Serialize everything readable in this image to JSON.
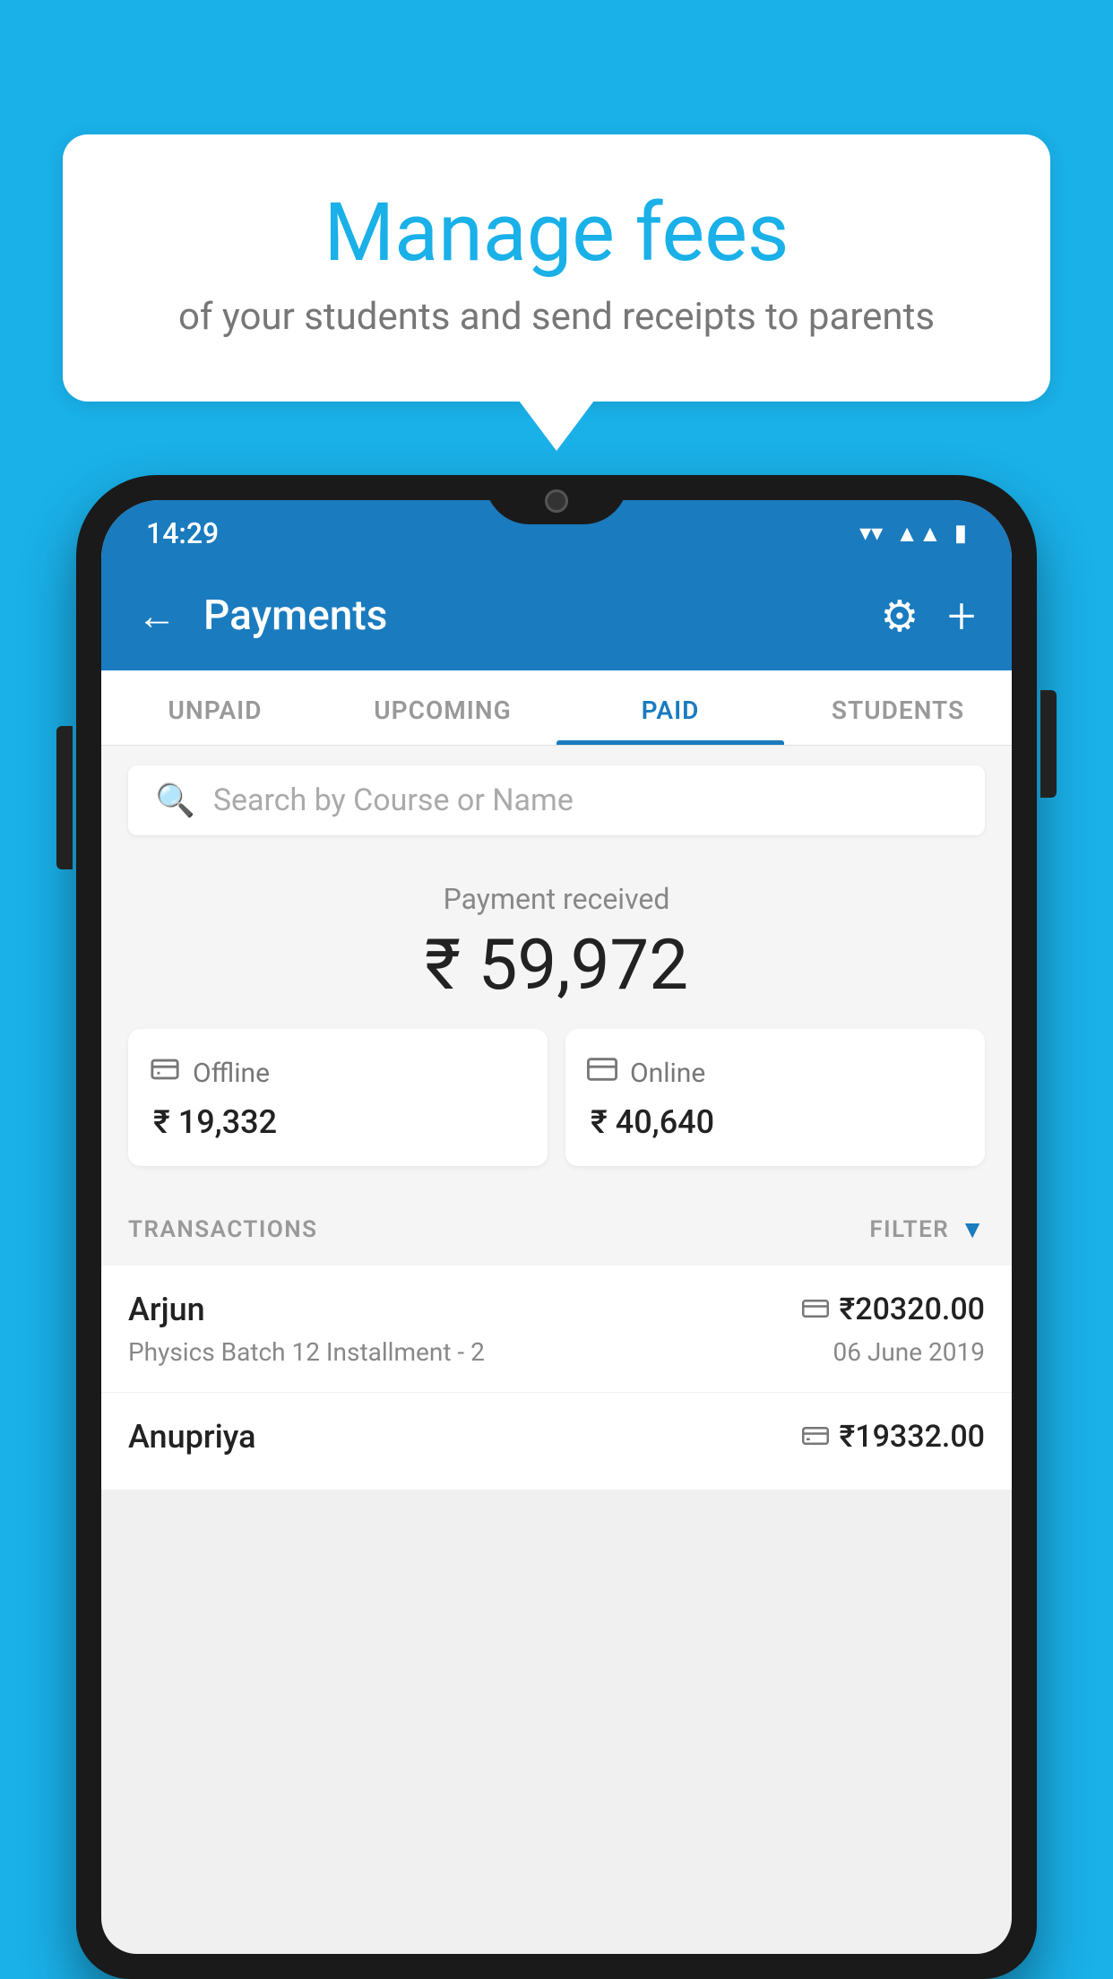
{
  "background_color": "#1ab0e8",
  "speech_bubble": {
    "title": "Manage fees",
    "subtitle": "of your students and send receipts to parents"
  },
  "status_bar": {
    "time": "14:29",
    "wifi": "▼",
    "signal": "▲",
    "battery": "▮"
  },
  "app_bar": {
    "title": "Payments",
    "back_label": "←",
    "gear_label": "⚙",
    "plus_label": "+"
  },
  "tabs": [
    {
      "label": "UNPAID",
      "active": false
    },
    {
      "label": "UPCOMING",
      "active": false
    },
    {
      "label": "PAID",
      "active": true
    },
    {
      "label": "STUDENTS",
      "active": false
    }
  ],
  "search": {
    "placeholder": "Search by Course or Name"
  },
  "payment_summary": {
    "label": "Payment received",
    "amount": "₹ 59,972",
    "offline": {
      "icon": "💳",
      "label": "Offline",
      "amount": "₹ 19,332"
    },
    "online": {
      "icon": "💳",
      "label": "Online",
      "amount": "₹ 40,640"
    }
  },
  "transactions_section": {
    "label": "TRANSACTIONS",
    "filter_label": "FILTER"
  },
  "transactions": [
    {
      "name": "Arjun",
      "course": "Physics Batch 12 Installment - 2",
      "amount": "₹20320.00",
      "date": "06 June 2019",
      "method": "online"
    },
    {
      "name": "Anupriya",
      "course": "",
      "amount": "₹19332.00",
      "date": "",
      "method": "offline"
    }
  ]
}
